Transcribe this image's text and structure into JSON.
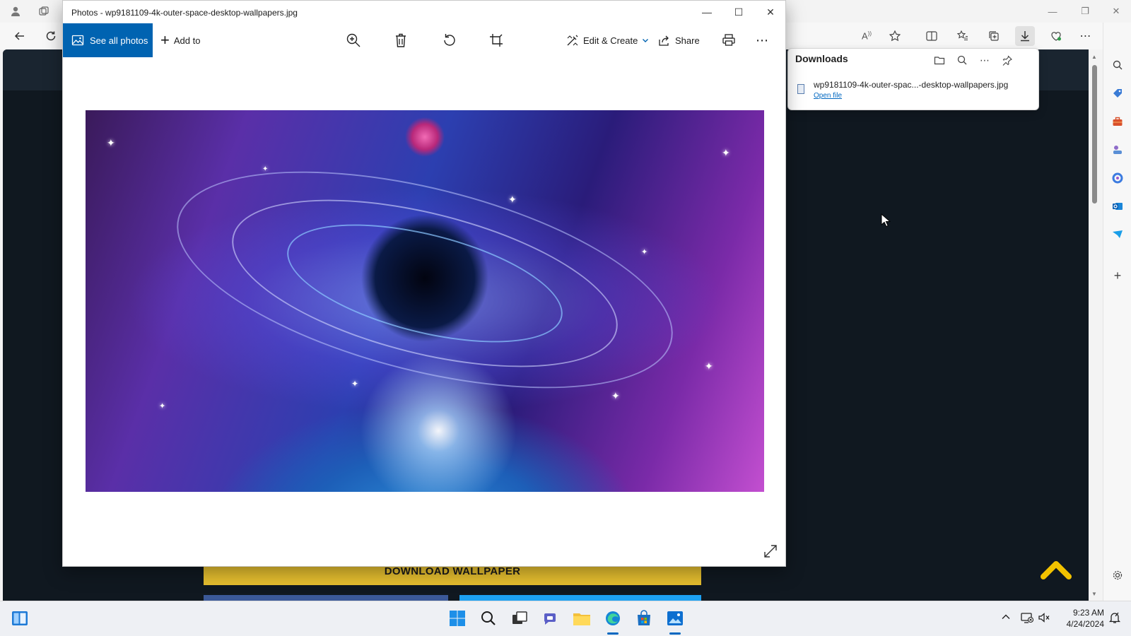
{
  "photos": {
    "window_title": "Photos - wp9181109-4k-outer-space-desktop-wallpapers.jpg",
    "see_all_photos": "See all photos",
    "add_to": "Add to",
    "edit_create": "Edit & Create",
    "share": "Share"
  },
  "downloads": {
    "title": "Downloads",
    "file_name": "wp9181109-4k-outer-spac...-desktop-wallpapers.jpg",
    "open_file": "Open file"
  },
  "webpage": {
    "download_button": "DOWNLOAD WALLPAPER"
  },
  "taskbar": {
    "time": "9:23 AM",
    "date": "4/24/2024"
  },
  "colors": {
    "photos_accent": "#0063b1",
    "download_button": "#e5be2f",
    "scroll_top_arrow": "#f2c200"
  }
}
